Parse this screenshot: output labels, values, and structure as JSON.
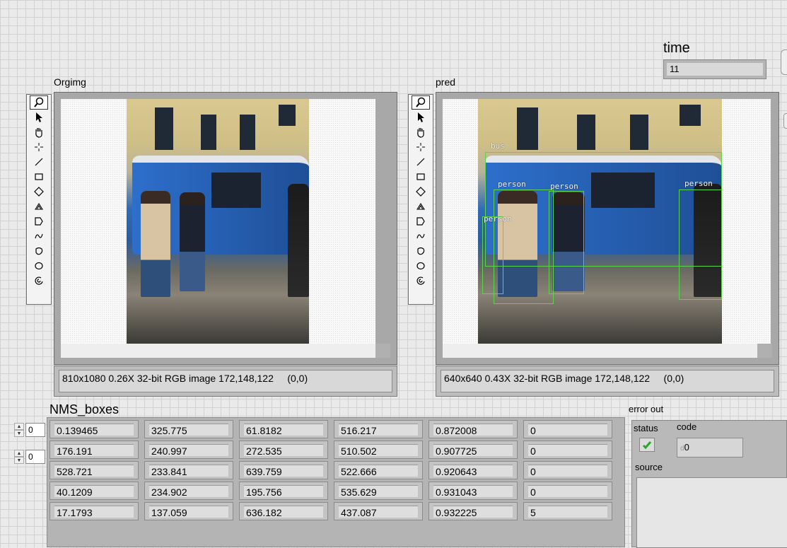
{
  "time": {
    "label": "time",
    "value": "11"
  },
  "orig_panel": {
    "label": "Orgimg",
    "status": "810x1080 0.26X 32-bit RGB image 172,148,122     (0,0)"
  },
  "pred_panel": {
    "label": "pred",
    "status": "640x640 0.43X 32-bit RGB image 172,148,122     (0,0)",
    "detections": [
      {
        "label": "bus"
      },
      {
        "label": "person"
      },
      {
        "label": "person"
      },
      {
        "label": "person"
      },
      {
        "label": "person"
      }
    ]
  },
  "tools": [
    "zoom-icon",
    "pointer-icon",
    "pan-icon",
    "crosshair-icon",
    "line-icon",
    "rectangle-icon",
    "rotated-rectangle-icon",
    "annulus-icon",
    "polygon-icon",
    "freehand-line-icon",
    "freehand-region-icon",
    "oval-icon",
    "broken-annulus-icon"
  ],
  "nms": {
    "label": "NMS_boxes",
    "index_row": "0",
    "index_col": "0",
    "rows": [
      [
        "0.139465",
        "325.775",
        "61.8182",
        "516.217",
        "0.872008",
        "0"
      ],
      [
        "176.191",
        "240.997",
        "272.535",
        "510.502",
        "0.907725",
        "0"
      ],
      [
        "528.721",
        "233.841",
        "639.759",
        "522.666",
        "0.920643",
        "0"
      ],
      [
        "40.1209",
        "234.902",
        "195.756",
        "535.629",
        "0.931043",
        "0"
      ],
      [
        "17.1793",
        "137.059",
        "636.182",
        "437.087",
        "0.932225",
        "5"
      ]
    ]
  },
  "error_out": {
    "label": "error out",
    "status_label": "status",
    "code_label": "code",
    "code_value": "0",
    "code_prefix": "d",
    "source_label": "source",
    "status_ok": true
  }
}
